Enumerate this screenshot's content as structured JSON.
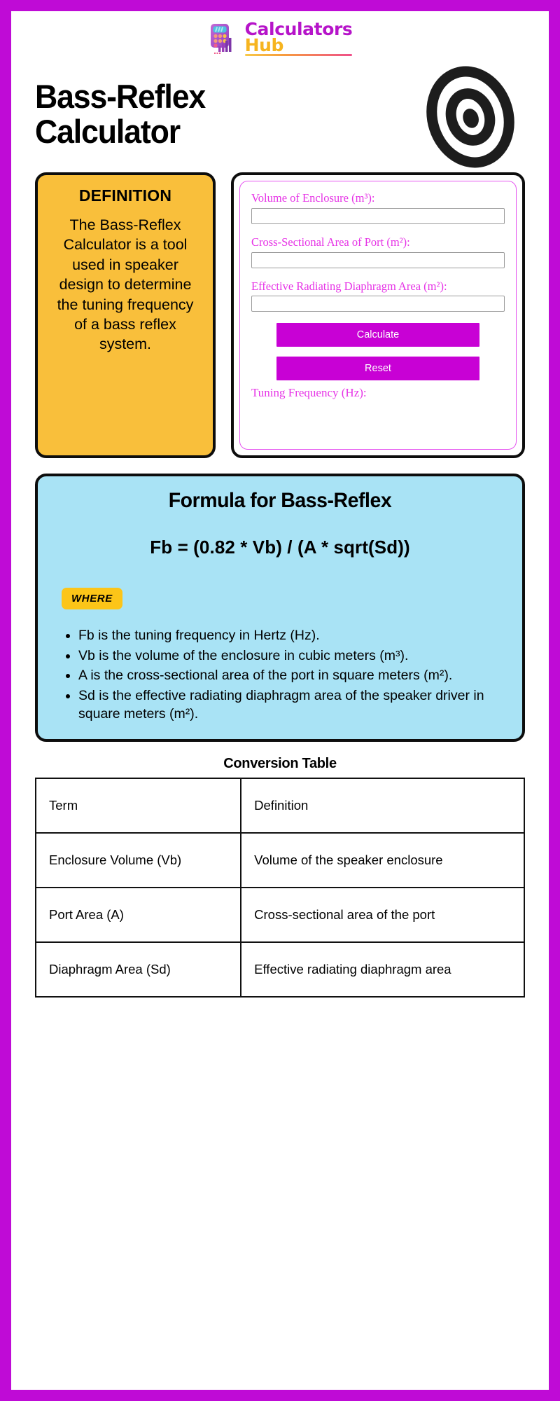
{
  "frame": {
    "border_color": "#bf0bd6",
    "background": "#ffffff"
  },
  "logo": {
    "icon_name": "calculator-chart-logo-icon",
    "line1": "Calculators",
    "line2": "Hub"
  },
  "header": {
    "title": "Bass-Reflex Calculator",
    "icon_name": "speaker-driver-icon"
  },
  "definition_card": {
    "title": "DEFINITION",
    "body": "The Bass-Reflex Calculator is a tool used in speaker design to determine the tuning frequency of a bass reflex system.",
    "background": "#f9bf3b"
  },
  "calculator": {
    "fields": [
      {
        "label": "Volume of Enclosure (m³):",
        "value": "",
        "placeholder": ""
      },
      {
        "label": "Cross-Sectional Area of Port (m²):",
        "value": "",
        "placeholder": ""
      },
      {
        "label": "Effective Radiating Diaphragm Area (m²):",
        "value": "",
        "placeholder": ""
      }
    ],
    "calculate_label": "Calculate",
    "reset_label": "Reset",
    "result_label": "Tuning Frequency (Hz):",
    "result_value": "",
    "accent_color": "#c801d5",
    "label_color": "#e633e6"
  },
  "formula_card": {
    "title": "Formula for Bass-Reflex",
    "expression": "Fb = (0.82 * Vb) / (A * sqrt(Sd))",
    "where_badge": "WHERE",
    "where_items": [
      "Fb is the tuning frequency in Hertz (Hz).",
      "Vb is the volume of the enclosure in cubic meters (m³).",
      "A is the cross-sectional area of the port in square meters (m²).",
      "Sd is the effective radiating diaphragm area of the speaker driver in square meters (m²)."
    ],
    "background": "#a9e3f5"
  },
  "conversion_table": {
    "heading": "Conversion Table",
    "columns": [
      "Term",
      "Definition"
    ],
    "rows": [
      {
        "term": "Enclosure Volume (Vb)",
        "definition": "Volume of the speaker enclosure"
      },
      {
        "term": "Port Area (A)",
        "definition": "Cross-sectional area of the port"
      },
      {
        "term": "Diaphragm Area (Sd)",
        "definition": "Effective radiating diaphragm area"
      }
    ]
  }
}
